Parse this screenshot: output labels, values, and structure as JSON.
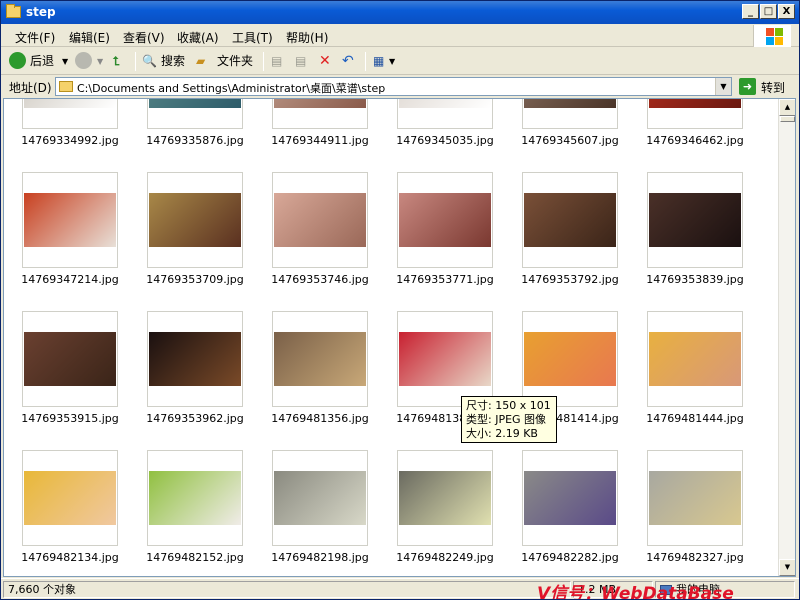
{
  "window": {
    "title": "step",
    "minimize_label": "_",
    "maximize_label": "□",
    "close_label": "X"
  },
  "menu": [
    "文件(F)",
    "编辑(E)",
    "查看(V)",
    "收藏(A)",
    "工具(T)",
    "帮助(H)"
  ],
  "toolbar": {
    "back_label": "后退",
    "search_label": "搜索",
    "folders_label": "文件夹"
  },
  "address": {
    "label": "地址(D)",
    "path": "C:\\Documents and Settings\\Administrator\\桌面\\菜谱\\step",
    "go_label": "转到"
  },
  "files": [
    {
      "name": "14769334992.jpg",
      "colors": [
        "#c8c2b8",
        "#ffffff"
      ]
    },
    {
      "name": "14769335876.jpg",
      "colors": [
        "#5a8a8a",
        "#2e5c6a"
      ]
    },
    {
      "name": "14769344911.jpg",
      "colors": [
        "#c2a090",
        "#8a5a4a"
      ]
    },
    {
      "name": "14769345035.jpg",
      "colors": [
        "#d8d0c8",
        "#ffffff"
      ]
    },
    {
      "name": "14769345607.jpg",
      "colors": [
        "#8a7060",
        "#4a3428"
      ]
    },
    {
      "name": "14769346462.jpg",
      "colors": [
        "#b83020",
        "#6a1810"
      ]
    },
    {
      "name": "14769347214.jpg",
      "colors": [
        "#c84020",
        "#e8e0d8"
      ]
    },
    {
      "name": "14769353709.jpg",
      "colors": [
        "#a88848",
        "#5a3020"
      ]
    },
    {
      "name": "14769353746.jpg",
      "colors": [
        "#d8a898",
        "#9a6858"
      ]
    },
    {
      "name": "14769353771.jpg",
      "colors": [
        "#c88880",
        "#7a3830"
      ]
    },
    {
      "name": "14769353792.jpg",
      "colors": [
        "#7a5038",
        "#3a2418"
      ]
    },
    {
      "name": "14769353839.jpg",
      "colors": [
        "#4a3028",
        "#1a1010"
      ]
    },
    {
      "name": "14769353915.jpg",
      "colors": [
        "#6a4030",
        "#3a2418"
      ]
    },
    {
      "name": "14769353962.jpg",
      "colors": [
        "#1a1010",
        "#7a4a28"
      ]
    },
    {
      "name": "14769481356.jpg",
      "colors": [
        "#7a6048",
        "#c8a878"
      ]
    },
    {
      "name": "14769481380.jpg",
      "colors": [
        "#c82030",
        "#e8d8c8"
      ]
    },
    {
      "name": "14769481414.jpg",
      "colors": [
        "#e8a030",
        "#e87850"
      ]
    },
    {
      "name": "14769481444.jpg",
      "colors": [
        "#e8b040",
        "#d89878"
      ]
    },
    {
      "name": "14769482134.jpg",
      "colors": [
        "#e8b838",
        "#f0c8a0"
      ]
    },
    {
      "name": "14769482152.jpg",
      "colors": [
        "#90c040",
        "#f0ece8"
      ]
    },
    {
      "name": "14769482198.jpg",
      "colors": [
        "#8a8a80",
        "#d8d8c8"
      ]
    },
    {
      "name": "14769482249.jpg",
      "colors": [
        "#6a6a60",
        "#e0e0b0"
      ]
    },
    {
      "name": "14769482282.jpg",
      "colors": [
        "#8a8a88",
        "#5a4a88"
      ]
    },
    {
      "name": "14769482327.jpg",
      "colors": [
        "#a8a8a0",
        "#d8c890"
      ]
    }
  ],
  "tooltip": {
    "line1": "尺寸: 150 x 101",
    "line2": "类型: JPEG 图像",
    "line3": "大小: 2.19 KB"
  },
  "status": {
    "objects": "7,660 个对象",
    "size": "1.2 MB",
    "location": "我的电脑"
  },
  "watermark": "V信号：WebDataBase"
}
